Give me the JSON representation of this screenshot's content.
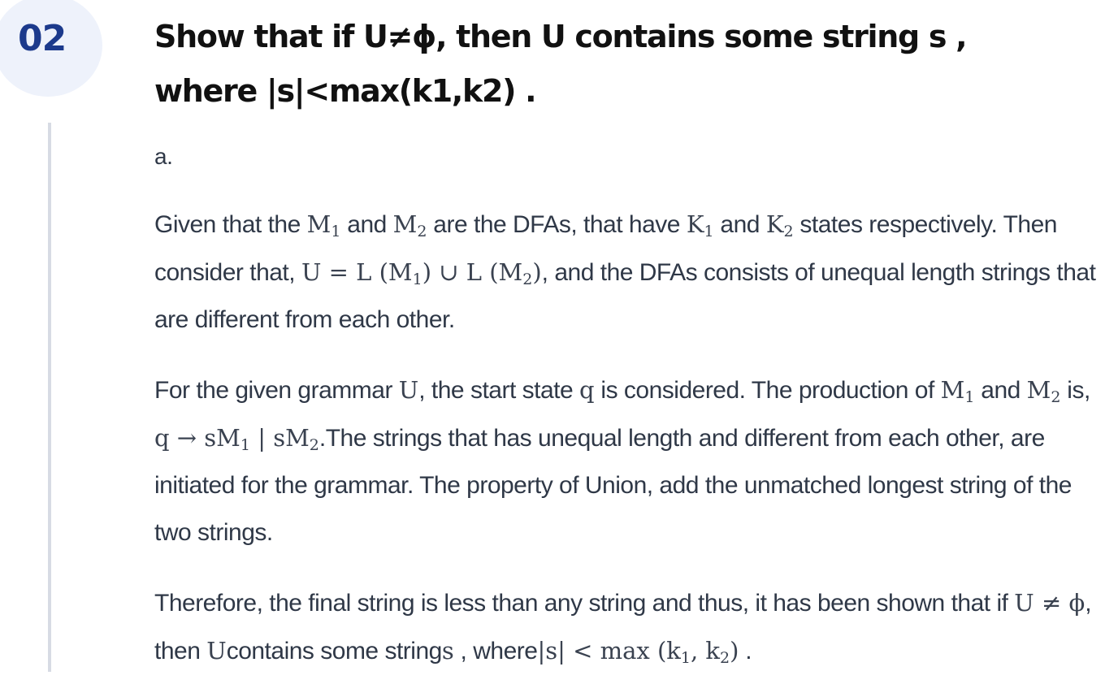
{
  "step": {
    "number": "02"
  },
  "question": {
    "line1": "Show that if  U≠ϕ, then  U  contains some string s ,",
    "line2": "where  |s|<max(k1,k2) ."
  },
  "solution": {
    "part_label": "a.",
    "paragraph1": {
      "t1": "Given that the ",
      "m1": "M",
      "m1_sub": "1",
      "t2": " and ",
      "m2": "M",
      "m2_sub": "2",
      "t3": " are the DFAs, that have ",
      "m3": "K",
      "m3_sub": "1",
      "t4": " and ",
      "m4": "K",
      "m4_sub": "2",
      "t5": " states respectively. Then consider that, ",
      "m5a": "U = L (M",
      "m5_sub1": "1",
      "m5b": ") ∪ L (M",
      "m5_sub2": "2",
      "m5c": ")",
      "t6": ", and the DFAs consists of unequal length strings that are different from each other."
    },
    "paragraph2": {
      "t1": "For the given grammar ",
      "m1": "U",
      "t2": ", the start state ",
      "m2": "q",
      "t3": " is considered. The production of ",
      "m3": "M",
      "m3_sub": "1",
      "t4": " and ",
      "m4": "M",
      "m4_sub": "2",
      "t5": " is, ",
      "m5a": "q → sM",
      "m5_sub1": "1",
      "m5b": " | sM",
      "m5_sub2": "2",
      "t6": ".The strings that has unequal length and different from each other, are initiated for the grammar. The property of Union, add the unmatched longest string of the two strings."
    },
    "paragraph3": {
      "t1": "Therefore, the final string is less than any string and thus, it has been shown that if ",
      "m1": "U ≠ ϕ",
      "t2": ", then ",
      "m2": "U",
      "t3": "contains some string",
      "m3": "s",
      "t4": " , where",
      "m4a": "|s| < max (k",
      "m4_sub1": "1",
      "m4b": ", k",
      "m4_sub2": "2",
      "m4c": ")",
      "t5": " ."
    }
  }
}
